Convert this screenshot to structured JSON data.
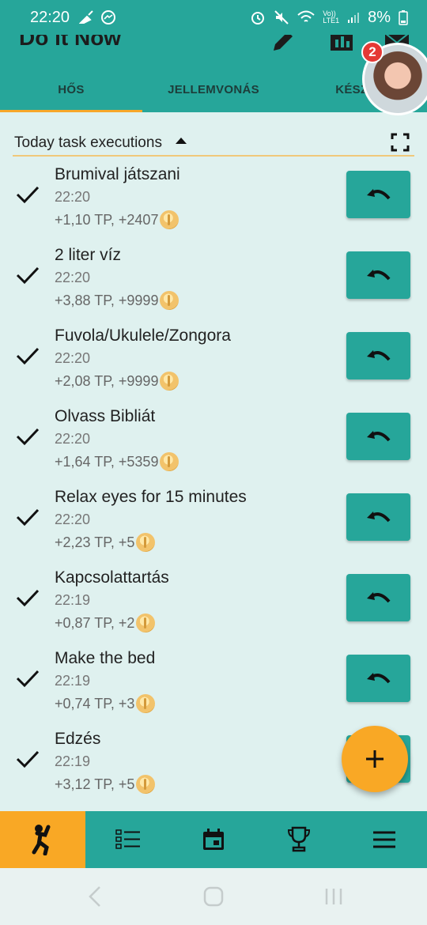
{
  "status_bar": {
    "time": "22:20",
    "battery_percent": "8%",
    "network_label_top": "Vo))",
    "network_label_bottom": "LTE1"
  },
  "app_bar": {
    "title": "Do it Now",
    "notification_count": "2"
  },
  "tabs": [
    {
      "label": "HŐS",
      "active": true
    },
    {
      "label": "JELLEMVONÁS",
      "active": false
    },
    {
      "label": "KÉSZS",
      "active": false
    }
  ],
  "section": {
    "title": "Today task executions"
  },
  "tasks": [
    {
      "name": "Brumival játszani",
      "time": "22:20",
      "reward": "+1,10 TP, +2407"
    },
    {
      "name": "2 liter víz",
      "time": "22:20",
      "reward": "+3,88 TP, +9999"
    },
    {
      "name": "Fuvola/Ukulele/Zongora",
      "time": "22:20",
      "reward": "+2,08 TP, +9999"
    },
    {
      "name": "Olvass Bibliát",
      "time": "22:20",
      "reward": "+1,64 TP, +5359"
    },
    {
      "name": "Relax eyes for 15 minutes",
      "time": "22:20",
      "reward": "+2,23 TP, +5"
    },
    {
      "name": "Kapcsolattartás",
      "time": "22:19",
      "reward": "+0,87 TP, +2"
    },
    {
      "name": "Make the bed",
      "time": "22:19",
      "reward": "+0,74 TP, +3"
    },
    {
      "name": "Edzés",
      "time": "22:19",
      "reward": "+3,12 TP, +5"
    }
  ],
  "colors": {
    "primary": "#26a69a",
    "accent": "#f9a825",
    "background": "#dff1ef"
  }
}
